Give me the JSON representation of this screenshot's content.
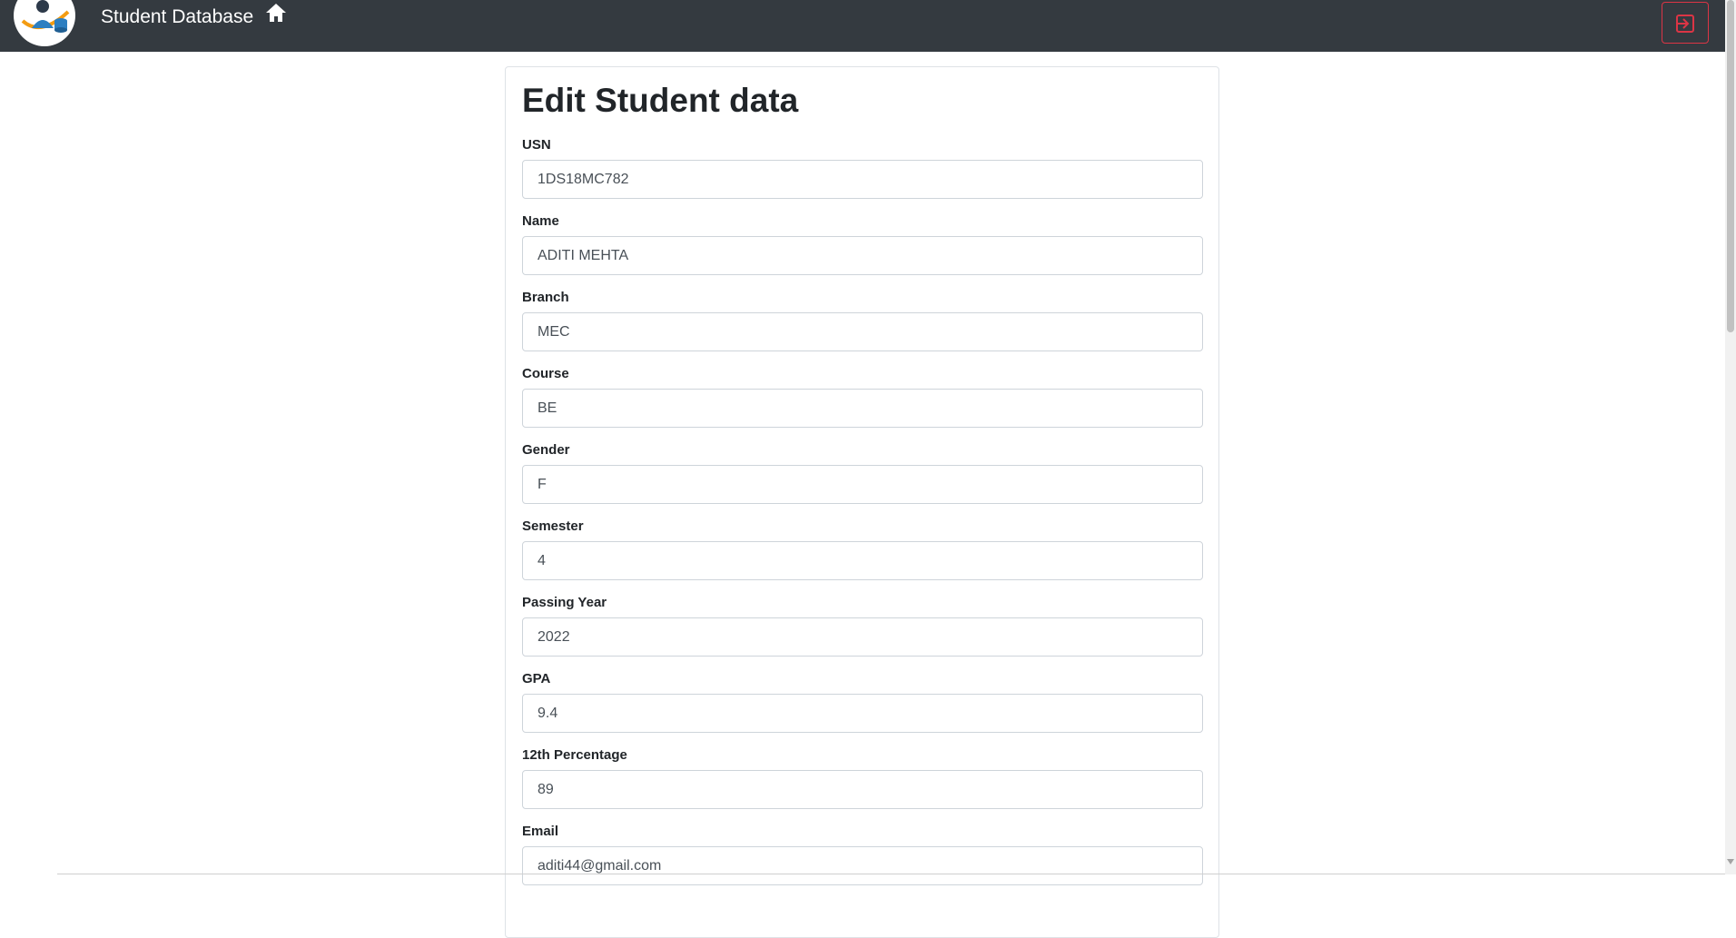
{
  "navbar": {
    "brand": "Student Database",
    "home_icon": "home-icon",
    "logout_icon": "logout-icon",
    "logout_color": "#dc3545",
    "background": "#343a40"
  },
  "form": {
    "title": "Edit Student data",
    "fields": [
      {
        "label": "USN",
        "value": "1DS18MC782"
      },
      {
        "label": "Name",
        "value": "ADITI MEHTA"
      },
      {
        "label": "Branch",
        "value": "MEC"
      },
      {
        "label": "Course",
        "value": "BE"
      },
      {
        "label": "Gender",
        "value": "F"
      },
      {
        "label": "Semester",
        "value": "4"
      },
      {
        "label": "Passing Year",
        "value": "2022"
      },
      {
        "label": "GPA",
        "value": "9.4"
      },
      {
        "label": "12th Percentage",
        "value": "89"
      },
      {
        "label": "Email",
        "value": "aditi44@gmail.com"
      }
    ]
  }
}
